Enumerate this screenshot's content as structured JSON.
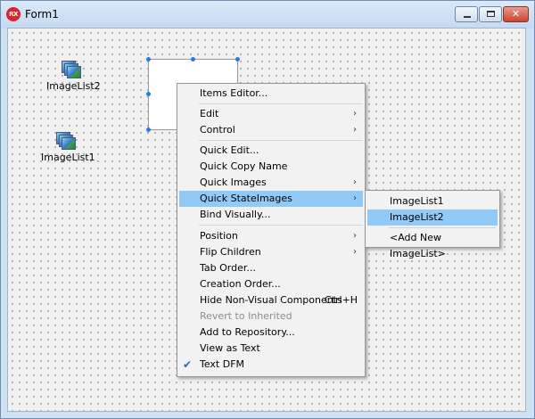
{
  "window": {
    "title": "Form1",
    "app_icon": "RX"
  },
  "components": [
    {
      "label": "ImageList2"
    },
    {
      "label": "ImageList1"
    }
  ],
  "menu": {
    "items": [
      {
        "label": "Items Editor...",
        "submenu": false
      },
      {
        "label": "Edit",
        "submenu": true
      },
      {
        "label": "Control",
        "submenu": true
      },
      {
        "label": "Quick Edit...",
        "submenu": false
      },
      {
        "label": "Quick Copy Name",
        "submenu": false
      },
      {
        "label": "Quick Images",
        "submenu": true
      },
      {
        "label": "Quick StateImages",
        "submenu": true,
        "highlighted": true
      },
      {
        "label": "Bind Visually...",
        "submenu": false
      },
      {
        "label": "Position",
        "submenu": true
      },
      {
        "label": "Flip Children",
        "submenu": true
      },
      {
        "label": "Tab Order...",
        "submenu": false
      },
      {
        "label": "Creation Order...",
        "submenu": false
      },
      {
        "label": "Hide Non-Visual Components",
        "shortcut": "Ctrl+H",
        "submenu": false
      },
      {
        "label": "Revert to Inherited",
        "submenu": false,
        "disabled": true
      },
      {
        "label": "Add to Repository...",
        "submenu": false
      },
      {
        "label": "View as Text",
        "submenu": false
      },
      {
        "label": "Text DFM",
        "submenu": false,
        "checked": true
      }
    ]
  },
  "submenu": {
    "items": [
      {
        "label": "ImageList1"
      },
      {
        "label": "ImageList2",
        "highlighted": true
      },
      {
        "label": "<Add New ImageList>"
      }
    ]
  },
  "colors": {
    "highlight": "#91c9f7",
    "close_button": "#c9452f",
    "selection_handle": "#2a7ae0"
  }
}
